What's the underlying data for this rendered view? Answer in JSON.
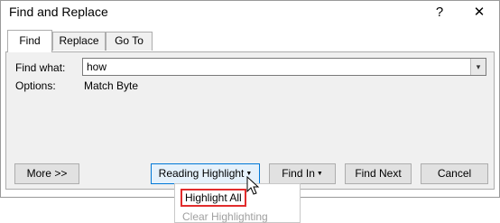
{
  "dialog": {
    "title": "Find and Replace",
    "help_glyph": "?",
    "close_glyph": "✕"
  },
  "tabs": [
    {
      "label": "Find",
      "active": true
    },
    {
      "label": "Replace",
      "active": false
    },
    {
      "label": "Go To",
      "active": false
    }
  ],
  "find": {
    "label": "Find what:",
    "value": "how",
    "dropdown_glyph": "▾"
  },
  "options": {
    "label": "Options:",
    "value": "Match Byte"
  },
  "buttons": {
    "more": "More >>",
    "reading_highlight": "Reading Highlight",
    "find_in": "Find In",
    "find_next": "Find Next",
    "cancel": "Cancel",
    "caret_glyph": "▼"
  },
  "menu": {
    "items": [
      {
        "label": "Highlight All",
        "enabled": true
      },
      {
        "label": "Clear Highlighting",
        "enabled": false
      }
    ]
  },
  "colors": {
    "highlight_outline": "#e22c2c",
    "focused_button_border": "#0078d7"
  }
}
